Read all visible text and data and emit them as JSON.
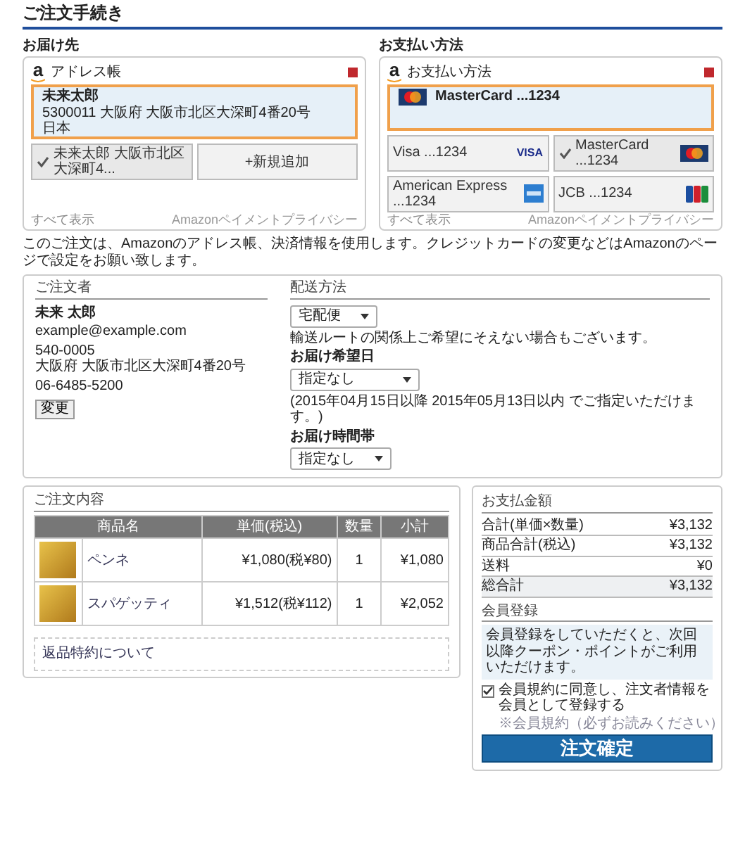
{
  "page_title": "ご注文手続き",
  "shipping": {
    "heading": "お届け先",
    "widget": {
      "logo": "a",
      "title": "アドレス帳"
    },
    "selected_address": {
      "name": "未来太郎",
      "line": "5300011 大阪府 大阪市北区大深町4番20号",
      "country": "日本"
    },
    "options": [
      {
        "label": "未来太郎 大阪市北区大深町4...",
        "selected": true
      },
      {
        "label": "+新規追加",
        "selected": false
      }
    ],
    "show_all": "すべて表示",
    "policy": "Amazonペイメントプライバシー"
  },
  "payment": {
    "heading": "お支払い方法",
    "widget": {
      "logo": "a",
      "title": "お支払い方法"
    },
    "selected_card": {
      "label": "MasterCard ...1234",
      "kind": "mastercard"
    },
    "cards": [
      {
        "label": "Visa ...1234",
        "kind": "visa",
        "logo_text": "VISA",
        "selected": false
      },
      {
        "label": "MasterCard ...1234",
        "kind": "mastercard",
        "selected": true
      },
      {
        "label": "American Express ...1234",
        "kind": "amex",
        "selected": false
      },
      {
        "label": "JCB ...1234",
        "kind": "jcb",
        "selected": false
      }
    ],
    "show_all": "すべて表示",
    "policy": "Amazonペイメントプライバシー"
  },
  "amazon_note": "このご注文は、Amazonのアドレス帳、決済情報を使用します。クレジットカードの変更などはAmazonのページで設定をお願い致します。",
  "customer": {
    "heading": "ご注文者",
    "name": "未来 太郎",
    "email": "example@example.com",
    "postal": "540-0005",
    "address": "大阪府 大阪市北区大深町4番20号",
    "phone": "06-6485-5200",
    "change_button": "変更"
  },
  "delivery": {
    "heading": "配送方法",
    "method": "宅配便",
    "route_note": "輸送ルートの関係上ご希望にそえない場合もございます。",
    "date": {
      "label": "お届け希望日",
      "value": "指定なし",
      "note": "(2015年04月15日以降 2015年05月13日以内 でご指定いただけます。)"
    },
    "time": {
      "label": "お届け時間帯",
      "value": "指定なし"
    }
  },
  "order": {
    "heading": "ご注文内容",
    "columns": [
      "商品名",
      "単価(税込)",
      "数量",
      "小計"
    ],
    "rows": [
      {
        "name": "ペンネ",
        "unit_price": "¥1,080(税¥80)",
        "quantity": "1",
        "subtotal": "¥1,080"
      },
      {
        "name": "スパゲッティ",
        "unit_price": "¥1,512(税¥112)",
        "quantity": "1",
        "subtotal": "¥2,052"
      }
    ],
    "returns_link": "返品特約について"
  },
  "summary": {
    "heading": "お支払金額",
    "rows": [
      {
        "label": "合計(単価×数量)",
        "value": "¥3,132",
        "kind": "line"
      },
      {
        "label": "商品合計(税込)",
        "value": "¥3,132",
        "kind": "line"
      },
      {
        "label": "送料",
        "value": "¥0",
        "kind": "line"
      },
      {
        "label": "総合計",
        "value": "¥3,132",
        "kind": "total"
      }
    ]
  },
  "membership": {
    "heading": "会員登録",
    "info": "会員登録をしていただくと、次回以降クーポン・ポイントがご利用いただけます。",
    "agree": {
      "label": "会員規約に同意し、注文者情報を会員として登録する",
      "checked": true
    },
    "terms_link": "※会員規約（必ずお読みください）",
    "submit": "注文確定"
  }
}
